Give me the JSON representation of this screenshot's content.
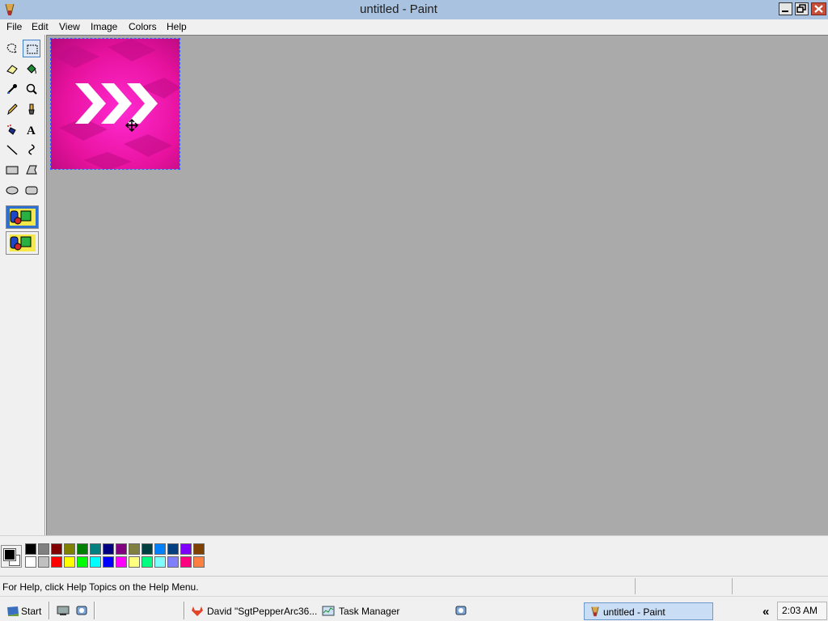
{
  "window": {
    "title": "untitled - Paint"
  },
  "menu": [
    "File",
    "Edit",
    "View",
    "Image",
    "Colors",
    "Help"
  ],
  "tools": [
    "free-form-select",
    "select",
    "eraser",
    "fill-with-color",
    "pick-color",
    "magnifier",
    "pencil",
    "brush",
    "airbrush",
    "text",
    "line",
    "curve",
    "rectangle",
    "polygon",
    "ellipse",
    "rounded-rectangle"
  ],
  "palette": {
    "foreground": "#000000",
    "background": "#ffffff",
    "row1": [
      "#000000",
      "#808080",
      "#800000",
      "#808000",
      "#008000",
      "#008080",
      "#000080",
      "#800080",
      "#808040",
      "#004040",
      "#0080ff",
      "#004080",
      "#8000ff",
      "#804000"
    ],
    "row2": [
      "#ffffff",
      "#c0c0c0",
      "#ff0000",
      "#ffff00",
      "#00ff00",
      "#00ffff",
      "#0000ff",
      "#ff00ff",
      "#ffff80",
      "#00ff80",
      "#80ffff",
      "#8080ff",
      "#ff0080",
      "#ff8040"
    ]
  },
  "status": {
    "help_text": "For Help, click Help Topics on the Help Menu."
  },
  "taskbar": {
    "start_label": "Start",
    "task_david": "David \"SgtPepperArc36...",
    "task_manager": "Task Manager",
    "task_paint": "untitled - Paint",
    "tray_chevron": "«",
    "clock": "2:03 AM"
  },
  "colors": {
    "titlebar": "#a9c2df",
    "workspace": "#aaaaaa",
    "canvas_magenta": "#e8129f"
  }
}
